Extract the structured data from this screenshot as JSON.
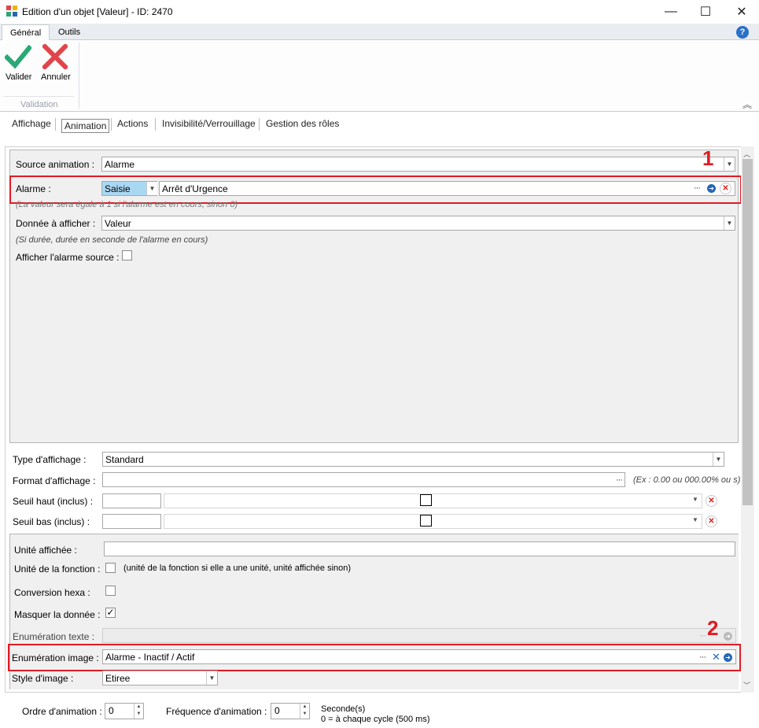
{
  "window": {
    "title": "Edition d'un objet [Valeur] - ID: 2470",
    "minimize": "—",
    "maximize": "☐",
    "close": "✕"
  },
  "ribbon": {
    "tabs": [
      "Général",
      "Outils"
    ],
    "valider_label": "Valider",
    "annuler_label": "Annuler",
    "group_label": "Validation",
    "help": "?"
  },
  "tabs": [
    "Affichage",
    "Animation",
    "Actions",
    "Invisibilité/Verrouillage",
    "Gestion des rôles"
  ],
  "animation": {
    "source_label": "Source animation :",
    "source_value": "Alarme",
    "alarme_label": "Alarme :",
    "alarme_mode": "Saisie",
    "alarme_value": "Arrêt d'Urgence",
    "alarme_hint": "(La valeur sera égale à 1 si l'alarme est en cours, sinon 0)",
    "donnee_label": "Donnée à afficher :",
    "donnee_value": "Valeur",
    "donnee_hint": "(Si durée, durée en seconde de l'alarme en cours)",
    "afficher_source_label": "Afficher l'alarme source :"
  },
  "display": {
    "type_label": "Type d'affichage :",
    "type_value": "Standard",
    "format_label": "Format d'affichage :",
    "format_value": "",
    "format_hint": "(Ex : 0.00 ou 000.00% ou s)",
    "seuil_haut_label": "Seuil haut (inclus) :",
    "seuil_bas_label": "Seuil bas (inclus) :",
    "unite_affichee_label": "Unité affichée :",
    "unite_fonction_label": "Unité de la fonction :",
    "unite_fonction_hint": "(unité de la fonction si elle a une unité, unité affichée sinon)",
    "conversion_label": "Conversion hexa :",
    "masquer_label": "Masquer la donnée :",
    "enum_texte_label": "Enumération texte :",
    "enum_image_label": "Enumération image :",
    "enum_image_value": "Alarme - Inactif / Actif",
    "style_label": "Style d'image :",
    "style_value": "Etiree"
  },
  "annotations": {
    "one": "1",
    "two": "2"
  },
  "footer": {
    "ordre_label": "Ordre d'animation :",
    "ordre_value": "0",
    "frequence_label": "Fréquence d'animation :",
    "frequence_value": "0",
    "seconde_label": "Seconde(s)",
    "cycle_hint": "0 = à chaque cycle (500 ms)"
  },
  "checkboxes": {
    "afficher_source": false,
    "unite_fonction": false,
    "conversion": false,
    "masquer": true
  },
  "colors": {
    "accent_red": "#e01b24",
    "valider_green": "#2aa876",
    "annuler_red": "#e0454a",
    "link_blue": "#2467b8"
  }
}
